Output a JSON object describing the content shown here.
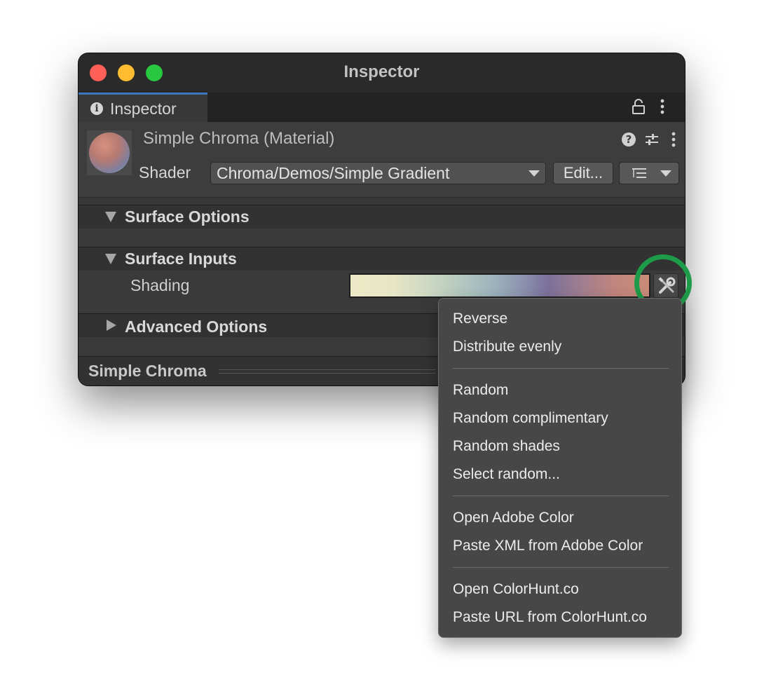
{
  "window": {
    "title": "Inspector"
  },
  "tab": {
    "label": "Inspector"
  },
  "material": {
    "name": "Simple Chroma (Material)",
    "shader_label": "Shader",
    "shader_value": "Chroma/Demos/Simple Gradient",
    "edit_label": "Edit..."
  },
  "sections": {
    "surface_options": "Surface Options",
    "surface_inputs": "Surface Inputs",
    "advanced_options": "Advanced Options"
  },
  "properties": {
    "shading_label": "Shading",
    "gradient_colors": [
      "#ede9c7",
      "#b9ccc0",
      "#9db4be",
      "#7b719b",
      "#c98b79"
    ]
  },
  "footer": {
    "title": "Simple Chroma"
  },
  "context_menu": {
    "groups": [
      [
        "Reverse",
        "Distribute evenly"
      ],
      [
        "Random",
        "Random complimentary",
        "Random shades",
        "Select random..."
      ],
      [
        "Open Adobe Color",
        "Paste XML from Adobe Color"
      ],
      [
        "Open ColorHunt.co",
        "Paste URL from ColorHunt.co"
      ]
    ]
  },
  "colors": {
    "window_bg": "#383838",
    "tab_accent": "#3a79bb",
    "highlight_ring": "#1e9b49",
    "menu_bg": "#474747"
  },
  "icons": [
    "info-icon",
    "lock-icon",
    "kebab-icon",
    "help-icon",
    "preset-icon",
    "list-icon",
    "wrench-icon",
    "chevron-down-icon"
  ]
}
